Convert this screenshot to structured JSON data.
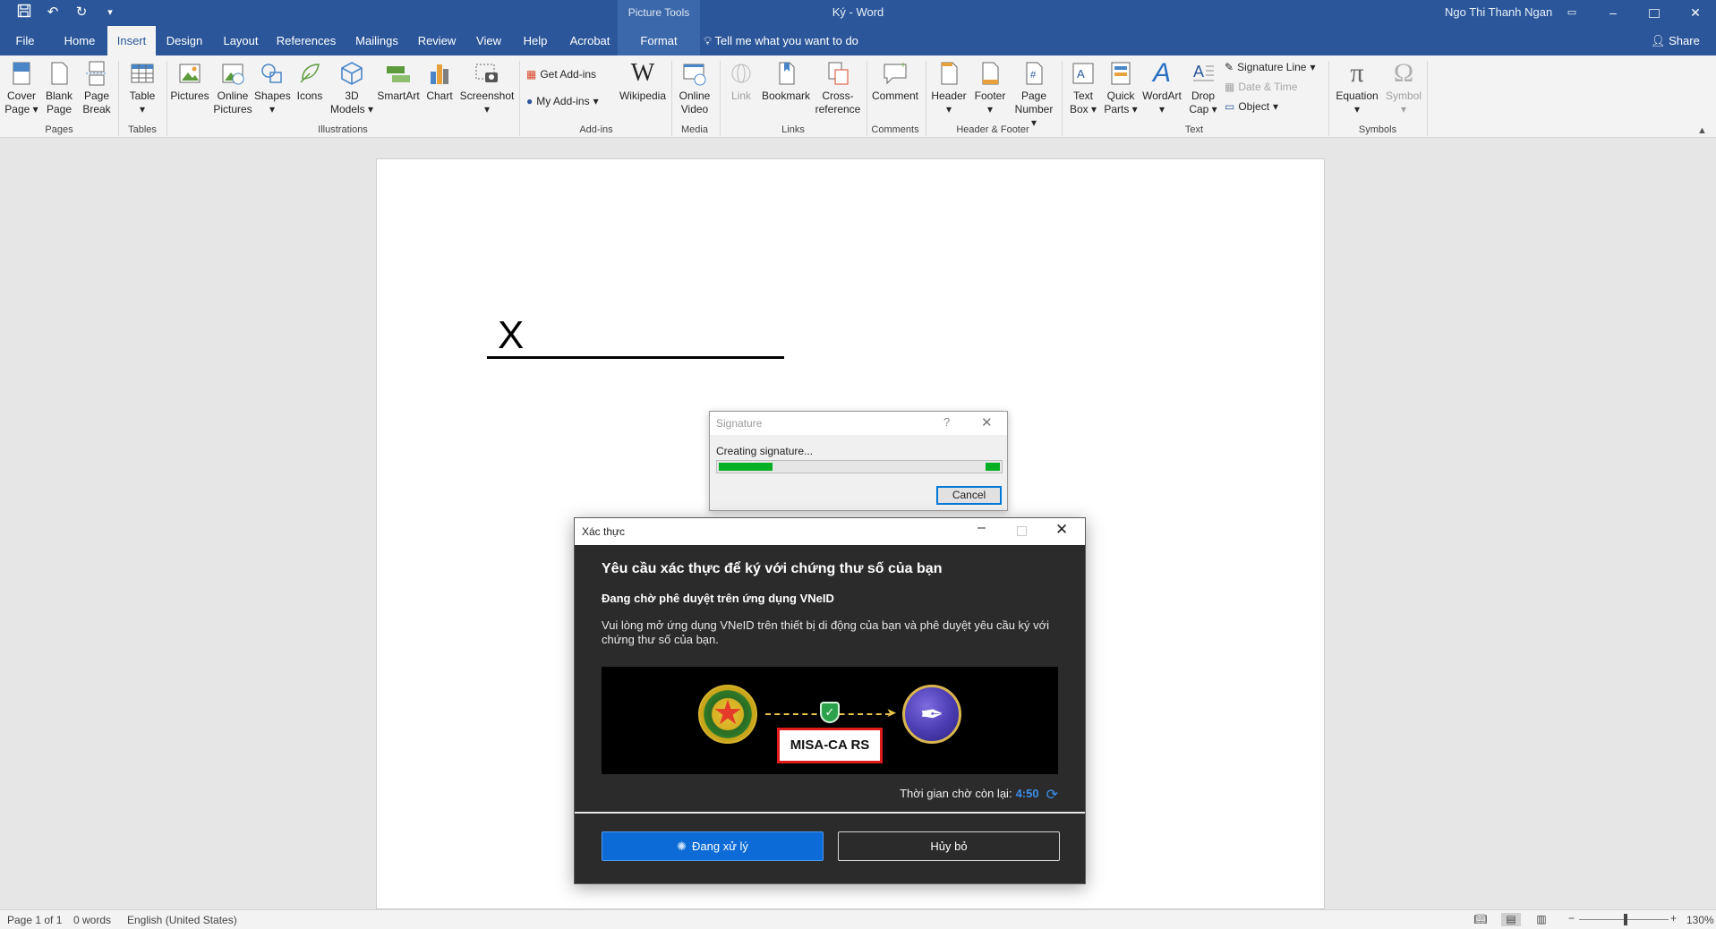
{
  "titlebar": {
    "picture_tools": "Picture Tools",
    "document_title": "Ký  -  Word",
    "user_name": "Ngo Thi Thanh Ngan",
    "qat": {
      "save": "save-icon",
      "undo": "undo-icon",
      "redo": "redo-icon",
      "customize": "customize-icon"
    }
  },
  "tabs": {
    "file": "File",
    "home": "Home",
    "insert": "Insert",
    "design": "Design",
    "layout": "Layout",
    "references": "References",
    "mailings": "Mailings",
    "review": "Review",
    "view": "View",
    "help": "Help",
    "acrobat": "Acrobat",
    "format": "Format",
    "tell_me": "Tell me what you want to do",
    "share": "Share"
  },
  "ribbon": {
    "pages": {
      "label": "Pages",
      "cover_1": "Cover",
      "cover_2": "Page",
      "blank_1": "Blank",
      "blank_2": "Page",
      "break_1": "Page",
      "break_2": "Break"
    },
    "tables": {
      "label": "Tables",
      "table": "Table"
    },
    "illustrations": {
      "label": "Illustrations",
      "pictures": "Pictures",
      "online_1": "Online",
      "online_2": "Pictures",
      "shapes": "Shapes",
      "icons": "Icons",
      "models_1": "3D",
      "models_2": "Models",
      "smartart": "SmartArt",
      "chart": "Chart",
      "screenshot": "Screenshot"
    },
    "addins": {
      "label": "Add-ins",
      "get": "Get Add-ins",
      "my": "My Add-ins",
      "wikipedia": "Wikipedia"
    },
    "media": {
      "label": "Media",
      "video_1": "Online",
      "video_2": "Video"
    },
    "links": {
      "label": "Links",
      "link": "Link",
      "bookmark": "Bookmark",
      "cross_1": "Cross-",
      "cross_2": "reference"
    },
    "comments": {
      "label": "Comments",
      "comment": "Comment"
    },
    "header_footer": {
      "label": "Header & Footer",
      "header": "Header",
      "footer": "Footer",
      "pagenum_1": "Page",
      "pagenum_2": "Number"
    },
    "text": {
      "label": "Text",
      "textbox_1": "Text",
      "textbox_2": "Box",
      "quick_1": "Quick",
      "quick_2": "Parts",
      "wordart": "WordArt",
      "drop_1": "Drop",
      "drop_2": "Cap",
      "sigline": "Signature Line",
      "datetime": "Date & Time",
      "object": "Object"
    },
    "symbols": {
      "label": "Symbols",
      "equation": "Equation",
      "symbol": "Symbol"
    }
  },
  "document": {
    "signature_x": "X"
  },
  "signature_dialog": {
    "title": "Signature",
    "help": "?",
    "status": "Creating signature...",
    "progress": 0.2,
    "cancel": "Cancel"
  },
  "auth_dialog": {
    "title": "Xác thực",
    "heading": "Yêu cầu xác thực để ký với chứng thư số của bạn",
    "subheading": "Đang chờ phê duyệt trên ứng dụng VNeID",
    "description": "Vui lòng mở ứng dụng VNeID trên thiết bị di động của bạn và phê duyệt yêu cầu ký với chứng thư số của bạn.",
    "banner_label": "MISA-CA RS",
    "timer_label": "Thời gian chờ còn lại:",
    "timer_value": "4:50",
    "processing_button": "Đang xử lý",
    "cancel_button": "Hủy bỏ",
    "accent_color": "#0c6bd6"
  },
  "statusbar": {
    "page": "Page 1 of 1",
    "words": "0 words",
    "language": "English (United States)",
    "zoom": "130%"
  }
}
